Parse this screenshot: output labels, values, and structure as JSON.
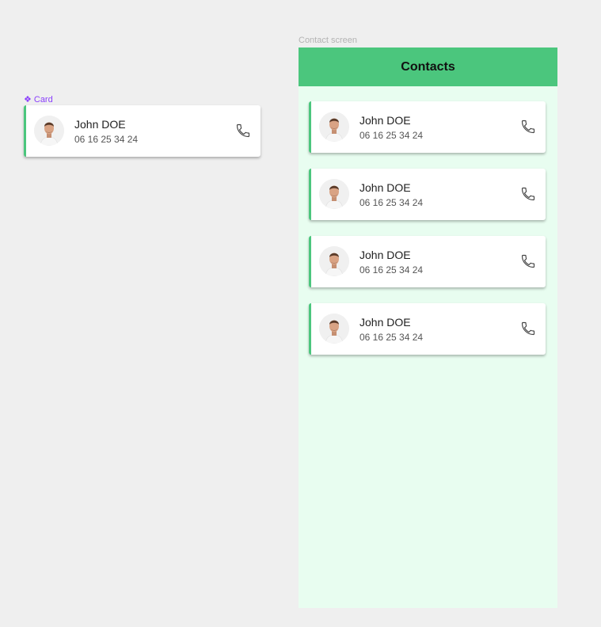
{
  "component": {
    "label": "Card",
    "icon": "component-icon",
    "card": {
      "name": "John DOE",
      "phone": "06 16 25 34 24",
      "call_icon": "phone-icon"
    }
  },
  "screen": {
    "frame_label": "Contact screen",
    "header": {
      "title": "Contacts"
    },
    "contacts": [
      {
        "name": "John DOE",
        "phone": "06 16 25 34 24"
      },
      {
        "name": "John DOE",
        "phone": "06 16 25 34 24"
      },
      {
        "name": "John DOE",
        "phone": "06 16 25 34 24"
      },
      {
        "name": "John DOE",
        "phone": "06 16 25 34 24"
      }
    ]
  },
  "colors": {
    "canvas": "#efefef",
    "accent_green": "#4bc67d",
    "screen_bg": "#e8fdf0",
    "component_purple": "#8a3ffc"
  }
}
